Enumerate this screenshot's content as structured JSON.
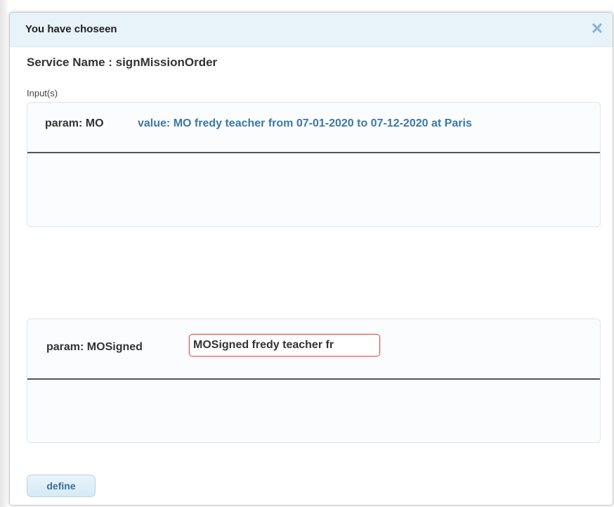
{
  "dialog": {
    "title": "You have choseen",
    "close_icon": "close-x-icon",
    "service_name": "Service Name : signMissionOrder",
    "inputs_label": "Input(s)"
  },
  "params": [
    {
      "name": "param: MO",
      "value": "value: MO fredy teacher from 07-01-2020 to 07-12-2020 at Paris"
    },
    {
      "name": "param: MOSigned",
      "input_value": "MOSigned fredy teacher fr"
    }
  ],
  "actions": {
    "define_label": "define"
  },
  "colors": {
    "titlebar_bg": "#e7f2f9",
    "value_text": "#3d77a8",
    "input_border_focus": "#d9534f",
    "button_bg": "#d6e9f6",
    "button_text": "#3a6d99"
  }
}
